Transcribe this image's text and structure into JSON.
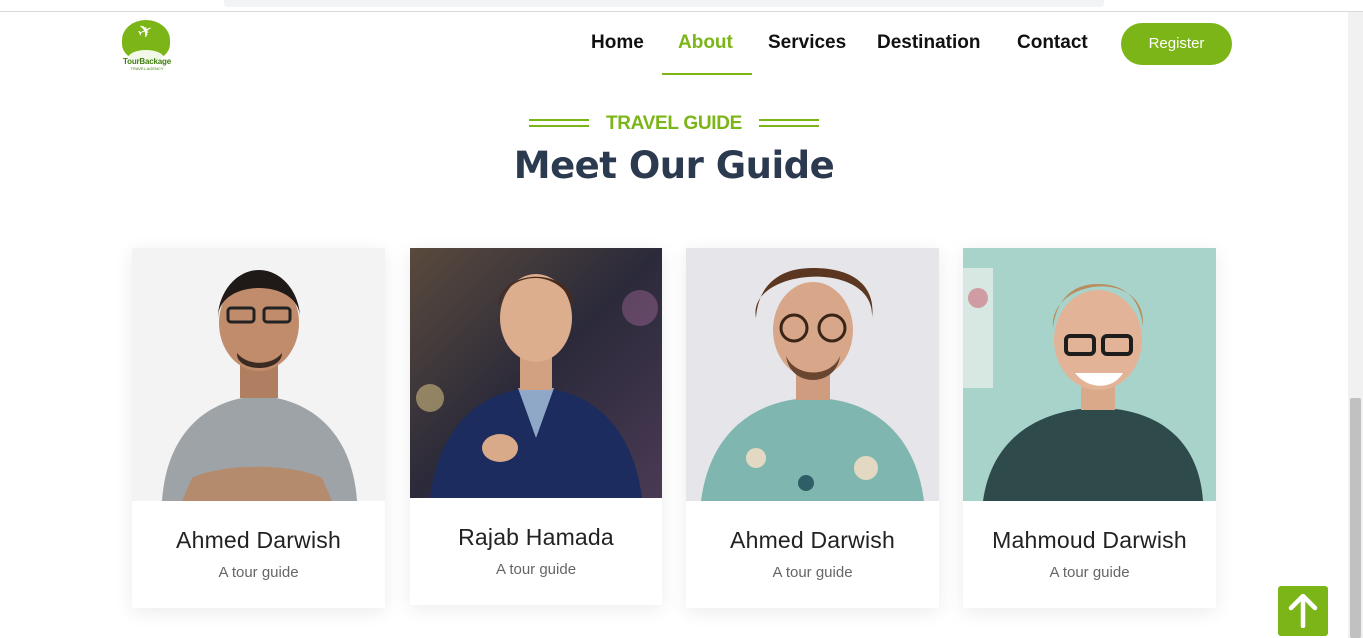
{
  "brand": {
    "name": "TourBackage",
    "tagline": "TRAVEL AGENCY"
  },
  "nav": {
    "items": [
      {
        "label": "Home"
      },
      {
        "label": "About",
        "active": true
      },
      {
        "label": "Services"
      },
      {
        "label": "Destination"
      },
      {
        "label": "Contact"
      }
    ],
    "register_label": "Register"
  },
  "section": {
    "subtitle": "TRAVEL GUIDE",
    "title": "Meet Our Guide"
  },
  "guides": [
    {
      "name": "Ahmed Darwish",
      "role": "A tour guide"
    },
    {
      "name": "Rajab Hamada",
      "role": "A tour guide"
    },
    {
      "name": "Ahmed Darwish",
      "role": "A tour guide"
    },
    {
      "name": "Mahmoud Darwish",
      "role": "A tour guide"
    }
  ],
  "colors": {
    "accent": "#7cb518",
    "heading": "#2b3a4f",
    "text": "#222222",
    "muted": "#666666"
  },
  "icons": {
    "scroll_top": "arrow-up-icon",
    "logo": "plane-icon"
  }
}
